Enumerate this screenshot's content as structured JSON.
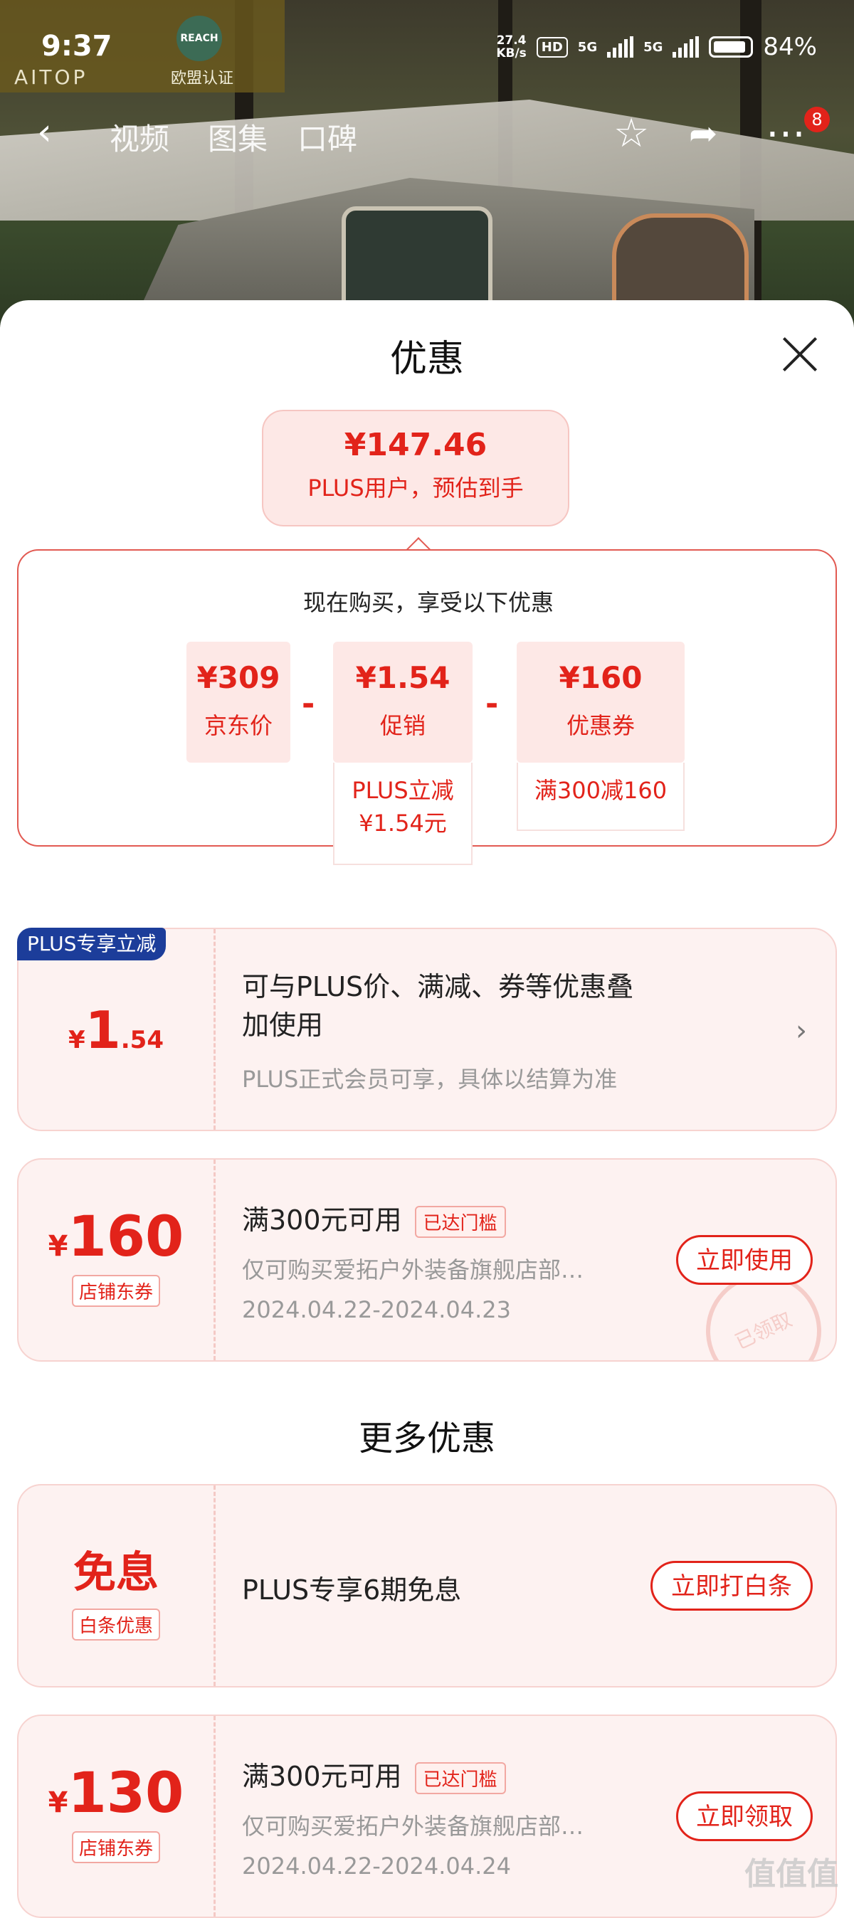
{
  "status_bar": {
    "time": "9:37",
    "brand": "AITOP",
    "reach_logo": "REACH",
    "reach_caption": "欧盟认证",
    "net_speed_value": "27.4",
    "net_speed_unit": "KB/s",
    "hd_label": "HD",
    "signal_1": "5G",
    "signal_2": "5G",
    "battery": "84%"
  },
  "nav": {
    "back_icon": "chevron-left",
    "tabs": [
      "视频",
      "图集",
      "口碑"
    ],
    "favorite_icon": "star-outline",
    "share_icon": "share-arrow",
    "more_icon": "more-dots",
    "more_badge": "8"
  },
  "sheet": {
    "title": "优惠",
    "close_icon": "close-x",
    "estimate": {
      "amount": "¥147.46",
      "label": "PLUS用户，预估到手"
    },
    "breakdown": {
      "title": "现在购买，享受以下优惠",
      "items": [
        {
          "value": "¥309",
          "label": "京东价"
        },
        {
          "value": "¥1.54",
          "label": "促销",
          "note": "PLUS立减\n¥1.54元"
        },
        {
          "value": "¥160",
          "label": "优惠券",
          "note": "满300减160"
        }
      ],
      "operator": "-"
    }
  },
  "cards": {
    "plus_reduce": {
      "tag": "PLUS专享立减",
      "currency": "¥",
      "amount_int": "1",
      "amount_dec": ".54",
      "title_line1": "可与PLUS价、满减、券等优惠叠",
      "title_line2": "加使用",
      "desc": "PLUS正式会员可享，具体以结算为准"
    },
    "coupon_160": {
      "currency": "¥",
      "amount": "160",
      "type": "店铺东券",
      "title": "满300元可用",
      "reached": "已达门槛",
      "desc": "仅可购买爱拓户外装备旗舰店部…",
      "date": "2024.04.22-2024.04.23",
      "button": "立即使用",
      "stamp": "已领取"
    },
    "more_title": "更多优惠",
    "interest_free": {
      "amount": "免息",
      "type": "白条优惠",
      "title": "PLUS专享6期免息",
      "button": "立即打白条"
    },
    "coupon_130": {
      "currency": "¥",
      "amount": "130",
      "type": "店铺东券",
      "title": "满300元可用",
      "reached": "已达门槛",
      "desc": "仅可购买爱拓户外装备旗舰店部…",
      "date": "2024.04.22-2024.04.24",
      "button": "立即领取"
    }
  },
  "watermark": "值值值",
  "colors": {
    "accent": "#e2231a",
    "card_bg": "#fdf2f1",
    "plus_tag": "#1c3d9a"
  }
}
